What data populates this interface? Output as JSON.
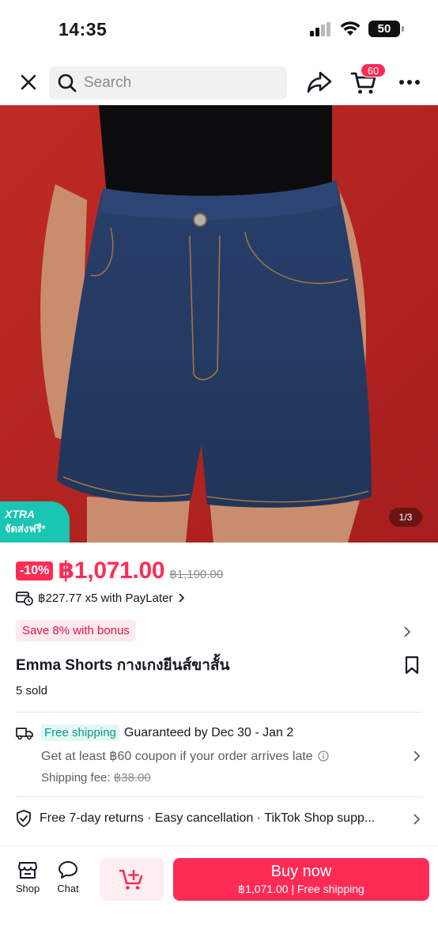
{
  "status_bar": {
    "time": "14:35",
    "battery": "50"
  },
  "header": {
    "search_placeholder": "Search",
    "cart_count": "60"
  },
  "hero": {
    "xtra_title": "XTRA",
    "xtra_subtitle": "จัดส่งฟรี*",
    "image_counter": "1/3",
    "background_color": "#b42323"
  },
  "product": {
    "discount": "-10%",
    "price": "฿1,071.00",
    "original_price": "฿1,190.00",
    "paylater": "฿227.77 x5 with PayLater",
    "bonus": "Save 8% with bonus",
    "title": "Emma Shorts กางเกงยีนส์ขาสั้น",
    "sold": "5 sold"
  },
  "shipping": {
    "free_tag": "Free shipping",
    "guarantee": "Guaranteed by Dec 30 - Jan 2",
    "coupon_note": "Get at least ฿60 coupon if your order arrives late",
    "fee_label": "Shipping fee:",
    "fee_value": "฿38.00"
  },
  "returns": {
    "text": "Free 7-day returns · Easy cancellation · TikTok Shop supp..."
  },
  "bottom_bar": {
    "shop_label": "Shop",
    "chat_label": "Chat",
    "buy_now_label": "Buy now",
    "buy_now_sub": "฿1,071.00 | Free shipping"
  },
  "colors": {
    "accent": "#fe2c55",
    "teal": "#19c5b3"
  }
}
